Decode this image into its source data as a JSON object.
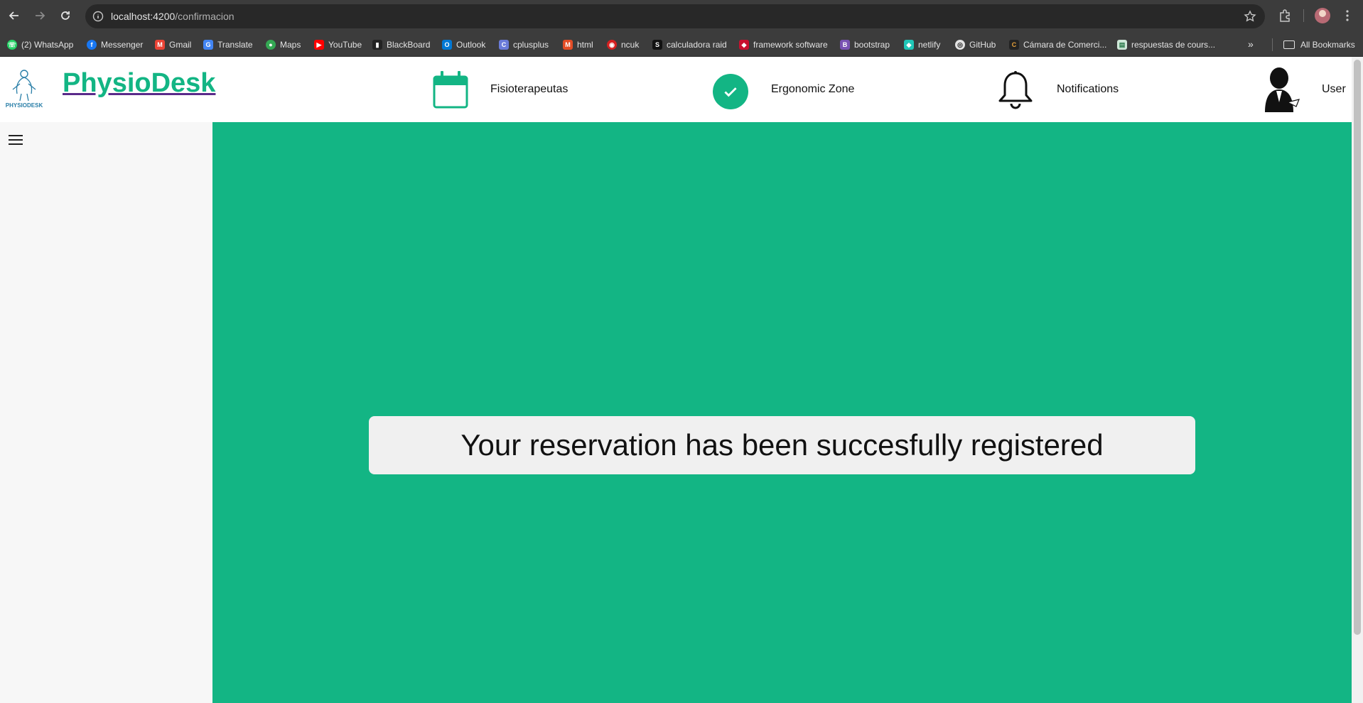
{
  "browser": {
    "url_host": "localhost:4200",
    "url_path": "/confirmacion",
    "bookmarks": [
      {
        "label": "(2) WhatsApp",
        "color": "#25d366",
        "icon": "whatsapp-icon",
        "glyph": "☏"
      },
      {
        "label": "Messenger",
        "color": "#1877f2",
        "icon": "facebook-icon",
        "glyph": "f"
      },
      {
        "label": "Gmail",
        "color": "#ea4335",
        "icon": "gmail-icon",
        "glyph": "M"
      },
      {
        "label": "Translate",
        "color": "#4285f4",
        "icon": "translate-icon",
        "glyph": "G"
      },
      {
        "label": "Maps",
        "color": "#34a853",
        "icon": "maps-icon",
        "glyph": "●"
      },
      {
        "label": "YouTube",
        "color": "#ff0000",
        "icon": "youtube-icon",
        "glyph": "▶"
      },
      {
        "label": "BlackBoard",
        "color": "#222222",
        "icon": "blackboard-icon",
        "glyph": "▮"
      },
      {
        "label": "Outlook",
        "color": "#0078d4",
        "icon": "outlook-icon",
        "glyph": "O"
      },
      {
        "label": "cplusplus",
        "color": "#6a7bd8",
        "icon": "cplusplus-icon",
        "glyph": "C"
      },
      {
        "label": "html",
        "color": "#e44d26",
        "icon": "html-icon",
        "glyph": "M"
      },
      {
        "label": "ncuk",
        "color": "#d42020",
        "icon": "ncuk-icon",
        "glyph": "◉"
      },
      {
        "label": "calculadora raid",
        "color": "#111111",
        "icon": "raid-calculator-icon",
        "glyph": "S"
      },
      {
        "label": "framework software",
        "color": "#c8102e",
        "icon": "framework-icon",
        "glyph": "◆"
      },
      {
        "label": "bootstrap",
        "color": "#7952b3",
        "icon": "bootstrap-icon",
        "glyph": "B"
      },
      {
        "label": "netlify",
        "color": "#20c6b7",
        "icon": "netlify-icon",
        "glyph": "◆"
      },
      {
        "label": "GitHub",
        "color": "#e3e3e3",
        "icon": "github-icon",
        "glyph": "◎"
      },
      {
        "label": "Cámara de Comerci...",
        "color": "#222222",
        "icon": "camara-icon",
        "glyph": "C"
      },
      {
        "label": "respuestas de cours...",
        "color": "#cfe8d8",
        "icon": "coursera-icon",
        "glyph": "▤"
      }
    ],
    "all_bookmarks": "All Bookmarks"
  },
  "header": {
    "brand": "PhysioDesk",
    "logo_caption": "PHYSIODESK",
    "nav": {
      "physio": "Fisioterapeutas",
      "ergonomic": "Ergonomic Zone",
      "notifications": "Notifications",
      "user": "User"
    }
  },
  "main": {
    "message": "Your reservation has been succesfully registered"
  },
  "colors": {
    "accent": "#13b584",
    "sidebar": "#f7f7f7",
    "message_bg": "#f0f0f0"
  }
}
